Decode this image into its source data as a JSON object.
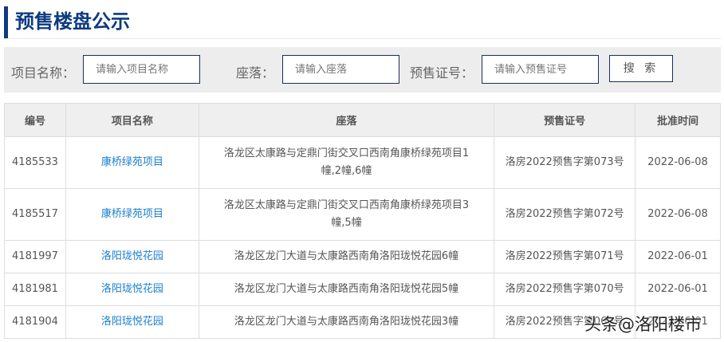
{
  "title": "预售楼盘公示",
  "search": {
    "name_label": "项目名称：",
    "name_placeholder": "请输入项目名称",
    "location_label": "座落：",
    "location_placeholder": "请输入座落",
    "cert_label": "预售证号：",
    "cert_placeholder": "请输入预售证号",
    "button": "搜 索"
  },
  "table": {
    "headers": [
      "编号",
      "项目名称",
      "座落",
      "预售证号",
      "批准时间"
    ],
    "rows": [
      {
        "id": "4185533",
        "name": "康桥绿苑项目",
        "location": "洛龙区太康路与定鼎门街交叉口西南角康桥绿苑项目1幢,2幢,6幢",
        "cert": "洛房2022预售字第073号",
        "date": "2022-06-08"
      },
      {
        "id": "4185517",
        "name": "康桥绿苑项目",
        "location": "洛龙区太康路与定鼎门街交叉口西南角康桥绿苑项目3幢,5幢",
        "cert": "洛房2022预售字第072号",
        "date": "2022-06-08"
      },
      {
        "id": "4181997",
        "name": "洛阳珑悦花园",
        "location": "洛龙区龙门大道与太康路西南角洛阳珑悦花园6幢",
        "cert": "洛房2022预售字第071号",
        "date": "2022-06-01"
      },
      {
        "id": "4181981",
        "name": "洛阳珑悦花园",
        "location": "洛龙区龙门大道与太康路西南角洛阳珑悦花园5幢",
        "cert": "洛房2022预售字第070号",
        "date": "2022-06-01"
      },
      {
        "id": "4181904",
        "name": "洛阳珑悦花园",
        "location": "洛龙区龙门大道与太康路西南角洛阳珑悦花园3幢",
        "cert": "洛房2022预售字第069号",
        "date": "2022-06-01"
      }
    ]
  },
  "watermark": "头条@洛阳楼市"
}
